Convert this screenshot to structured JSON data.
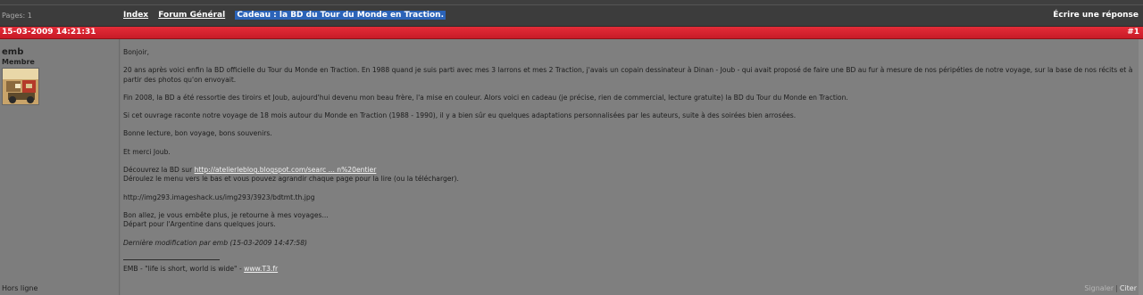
{
  "header": {
    "pages": "Pages: 1",
    "breadcrumb": {
      "index": "Index",
      "forum": "Forum Général",
      "topic": "Cadeau : la BD du Tour du Monde en Traction."
    },
    "reply_link": "Écrire une réponse"
  },
  "post": {
    "date": "15-03-2009 14:21:31",
    "number": "#1",
    "author": "emb",
    "role": "Membre",
    "status": "Hors ligne",
    "body": {
      "greeting": "Bonjoir,",
      "p1": "20 ans après voici enfin la BD officielle du Tour du Monde en Traction. En 1988 quand je suis parti avec mes 3 larrons et mes 2 Traction, j'avais un copain dessinateur à Dinan - Joub - qui avait proposé de faire une BD au fur à mesure de nos péripéties de notre voyage, sur la base de nos récits et à partir des photos qu'on envoyait.",
      "p2": "Fin 2008, la BD a été ressortie des tiroirs et Joub, aujourd'hui devenu mon beau frère, l'a mise en couleur. Alors voici en cadeau (je précise, rien de commercial, lecture gratuite) la BD du Tour du Monde en Traction.",
      "p3": "Si cet ouvrage raconte notre voyage de 18 mois autour du Monde en Traction (1988 - 1990), il y a bien sûr eu quelques adaptations personnalisées par les auteurs, suite à des soirées bien arrosées.",
      "p4": "Bonne lecture, bon voyage, bons souvenirs.",
      "p5": "Et merci Joub.",
      "discover_prefix": "Découvrez la BD sur ",
      "discover_link": "http://atelierleblog.blogspot.com/searc ... n%20entier",
      "instructions": "Déroulez le menu vers le bas et vous pouvez agrandir chaque page pour la lire (ou la télécharger).",
      "image_url": "http://img293.imageshack.us/img293/3923/bdtmt.th.jpg",
      "closing1": "Bon allez, je vous embête plus, je retourne à mes voyages...",
      "closing2": "Départ pour l'Argentine dans quelques jours.",
      "edit_note": "Dernière modification par emb (15-03-2009 14:47:58)"
    },
    "signature": {
      "text": "EMB  -  \"life is short, world is wide\" - ",
      "link": "www.T3.fr"
    },
    "actions": {
      "report": "Signaler",
      "separator": "|",
      "quote": "Citer"
    }
  },
  "colors": {
    "post_header": "#d6222e",
    "background": "#7f7f7f",
    "topic_highlight": "#2b63b8"
  }
}
